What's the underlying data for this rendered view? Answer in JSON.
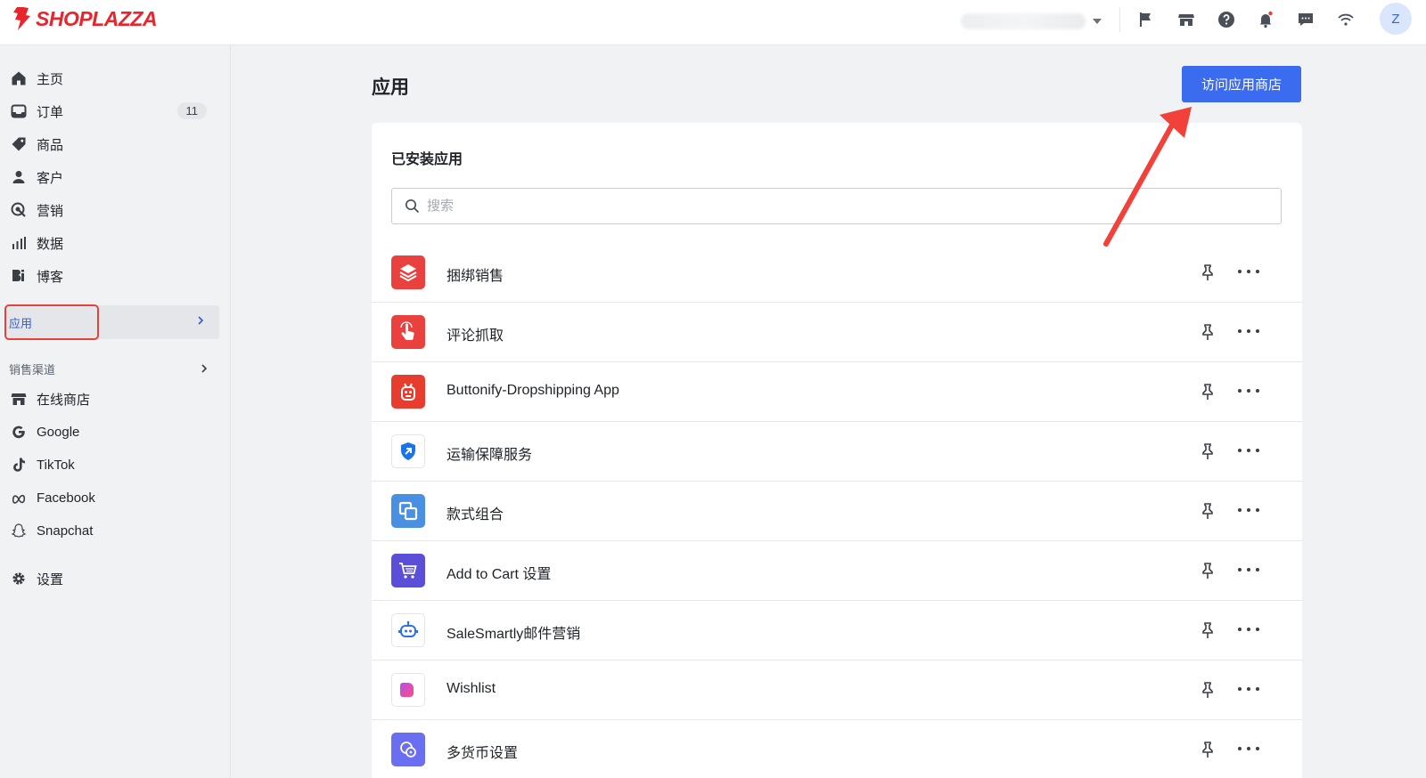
{
  "brand": {
    "name": "SHOPLAZZA",
    "color": "#e8242c"
  },
  "topbar": {
    "icons": [
      "flag-icon",
      "store-icon",
      "help-icon",
      "bell-icon",
      "chat-icon",
      "wifi-icon"
    ],
    "avatar_letter": "Z"
  },
  "sidebar": {
    "items": [
      {
        "label": "主页",
        "icon": "home-icon"
      },
      {
        "label": "订单",
        "icon": "inbox-icon",
        "badge": "11"
      },
      {
        "label": "商品",
        "icon": "tag-icon"
      },
      {
        "label": "客户",
        "icon": "person-icon"
      },
      {
        "label": "营销",
        "icon": "target-icon"
      },
      {
        "label": "数据",
        "icon": "bar-chart-icon"
      },
      {
        "label": "博客",
        "icon": "blog-icon"
      }
    ],
    "active": {
      "label": "应用"
    },
    "sales_channels_label": "销售渠道",
    "channels": [
      {
        "label": "在线商店",
        "icon": "store-icon"
      },
      {
        "label": "Google",
        "icon": "google-icon"
      },
      {
        "label": "TikTok",
        "icon": "tiktok-icon"
      },
      {
        "label": "Facebook",
        "icon": "meta-icon"
      },
      {
        "label": "Snapchat",
        "icon": "snapchat-icon"
      }
    ],
    "settings": {
      "label": "设置",
      "icon": "gear-icon"
    }
  },
  "main": {
    "title": "应用",
    "visit_store_button": "访问应用商店",
    "installed_title": "已安装应用",
    "search_placeholder": "搜索",
    "apps": [
      {
        "name": "捆绑销售",
        "icon": "layers-icon",
        "color": "#e9413d"
      },
      {
        "name": "评论抓取",
        "icon": "hand-pointer-icon",
        "color": "#e9413d"
      },
      {
        "name": "Buttonify-Dropshipping App",
        "icon": "robot-face-icon",
        "color": "#e73d2f"
      },
      {
        "name": "运输保障服务",
        "icon": "shield-arrow-icon",
        "color": "#1a73e8"
      },
      {
        "name": "款式组合",
        "icon": "overlap-squares-icon",
        "color": "#4a90e2"
      },
      {
        "name": "Add to Cart 设置",
        "icon": "cart-icon",
        "color": "#5b4fd9"
      },
      {
        "name": "SaleSmartly邮件营销",
        "icon": "bot-icon",
        "color": "#2f6fe6"
      },
      {
        "name": "Wishlist",
        "icon": "heart-icon",
        "color": "#f0488c"
      },
      {
        "name": "多货币设置",
        "icon": "currency-icon",
        "color": "#6a6ef0"
      }
    ]
  },
  "annotation": {
    "arrow_color": "#f2403a",
    "highlight_color": "#e5423b"
  }
}
